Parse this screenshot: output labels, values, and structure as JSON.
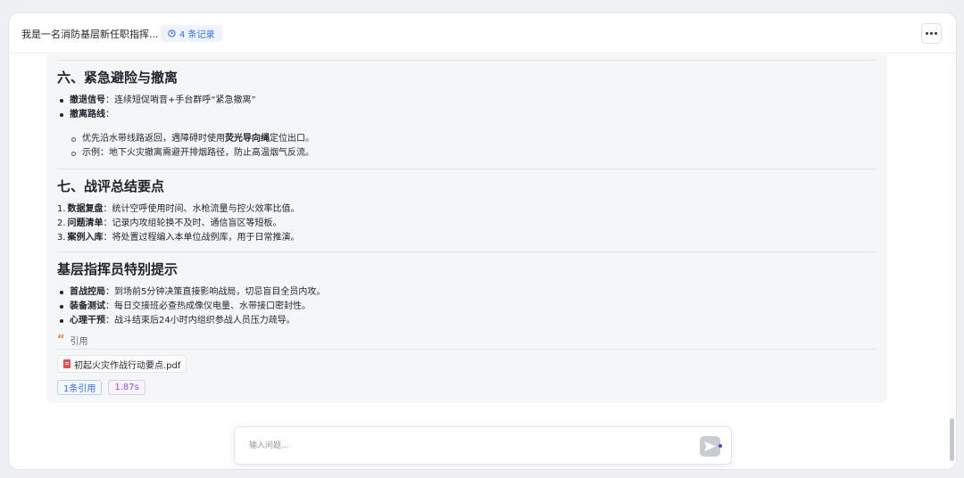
{
  "header": {
    "title": "我是一名消防基层新任职指挥...",
    "records_badge": "4 条记录"
  },
  "sections": {
    "s6": {
      "heading": "六、紧急避险与撤离",
      "items": [
        {
          "label": "撤退信号",
          "text": "：连续短促哨音+手台群呼“紧急撤离”"
        },
        {
          "label": "撤离路线",
          "text": "："
        }
      ],
      "subitems": [
        {
          "pre": "优先沿水带线路返回，遇障碍时使用",
          "bold": "荧光导向绳",
          "post": "定位出口。"
        },
        {
          "pre": "示例：地下火灾撤离需避开排烟路径，防止高温烟气反流。",
          "bold": "",
          "post": ""
        }
      ]
    },
    "s7": {
      "heading": "七、战评总结要点",
      "items": [
        {
          "num": "1.",
          "label": "数据复盘",
          "text": "：统计空呼使用时间、水枪流量与控火效率比值。"
        },
        {
          "num": "2.",
          "label": "问题清单",
          "text": "：记录内攻组轮换不及时、通信盲区等短板。"
        },
        {
          "num": "3.",
          "label": "案例入库",
          "text": "：将处置过程编入本单位战例库，用于日常推演。"
        }
      ]
    },
    "s8": {
      "heading": "基层指挥员特别提示",
      "items": [
        {
          "label": "首战控局",
          "text": "：到场前5分钟决策直接影响战局，切忌盲目全员内攻。"
        },
        {
          "label": "装备测试",
          "text": "：每日交接班必查热成像仪电量、水带接口密封性。"
        },
        {
          "label": "心理干预",
          "text": "：战斗结束后24小时内组织参战人员压力疏导。"
        }
      ]
    }
  },
  "citation": {
    "label": "引用",
    "file": "初起火灾作战行动要点.pdf",
    "count_tag": "1条引用",
    "time_tag": "1.87s"
  },
  "input": {
    "placeholder": "输入问题..."
  },
  "colors": {
    "accent": "#3370ff",
    "purple_tag": "#8b53e0",
    "pdf_red": "#f54a45"
  }
}
